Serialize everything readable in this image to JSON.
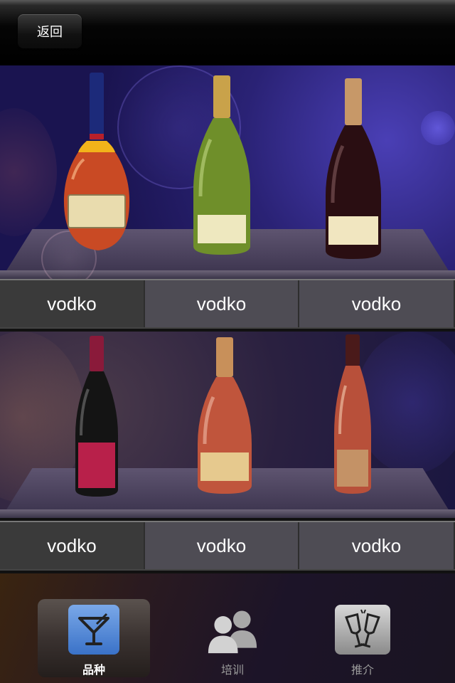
{
  "header": {
    "back_label": "返回"
  },
  "shelves": [
    {
      "labels": [
        "vodko",
        "vodko",
        "vodko"
      ]
    },
    {
      "labels": [
        "vodko",
        "vodko",
        "vodko"
      ]
    }
  ],
  "tabs": [
    {
      "label": "品种",
      "icon": "cocktail-glass-icon",
      "active": true
    },
    {
      "label": "培训",
      "icon": "people-icon",
      "active": false
    },
    {
      "label": "推介",
      "icon": "champagne-toast-icon",
      "active": false
    }
  ],
  "colors": {
    "accent_blue": "#3a7bd5",
    "label_active": "#ffffff",
    "label_inactive": "#9a9a9a"
  }
}
